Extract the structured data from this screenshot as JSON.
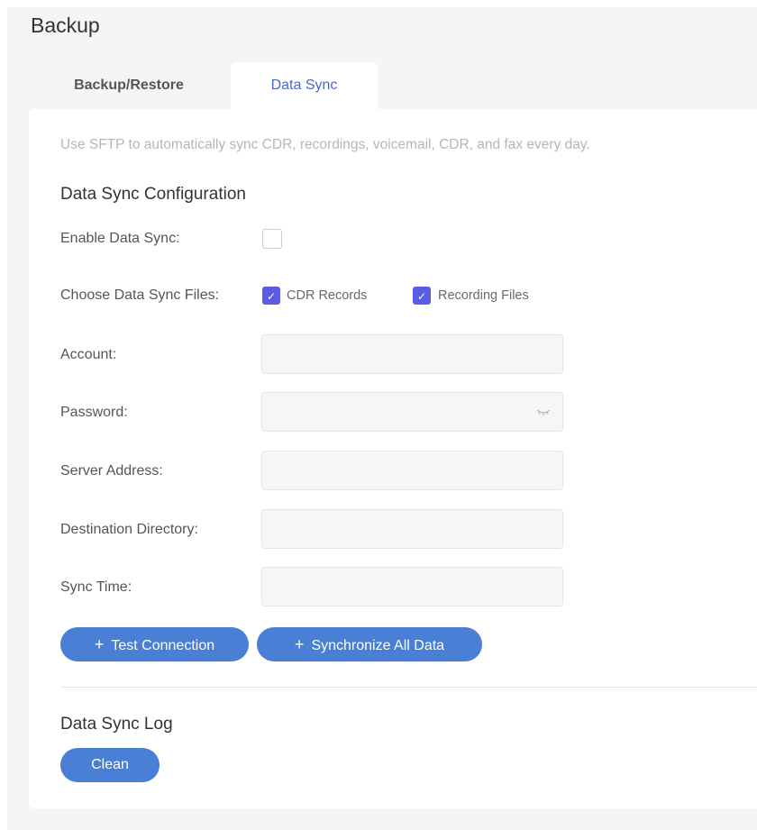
{
  "page": {
    "title": "Backup"
  },
  "tabs": [
    {
      "label": "Backup/Restore",
      "active": false
    },
    {
      "label": "Data Sync",
      "active": true
    }
  ],
  "description": "Use SFTP to automatically sync CDR, recordings, voicemail, CDR, and fax every day.",
  "config": {
    "title": "Data Sync Configuration",
    "enable": {
      "label": "Enable Data Sync:",
      "checked": false
    },
    "files": {
      "label": "Choose Data Sync Files:",
      "options": [
        {
          "label": "CDR Records",
          "checked": true
        },
        {
          "label": "Recording Files",
          "checked": true
        }
      ]
    },
    "account": {
      "label": "Account:",
      "value": ""
    },
    "password": {
      "label": "Password:",
      "value": "",
      "icon": "eye-closed-icon"
    },
    "server": {
      "label": "Server Address:",
      "value": ""
    },
    "directory": {
      "label": "Destination Directory:",
      "value": ""
    },
    "sync_time": {
      "label": "Sync Time:",
      "value": ""
    }
  },
  "buttons": {
    "test": "Test Connection",
    "sync_all": "Synchronize All Data",
    "plus": "+"
  },
  "log": {
    "title": "Data Sync Log",
    "clean": "Clean"
  },
  "colors": {
    "accent": "#4a7fd6",
    "tab_active_text": "#4a68c9",
    "checkbox_checked": "#5b5ce6"
  }
}
